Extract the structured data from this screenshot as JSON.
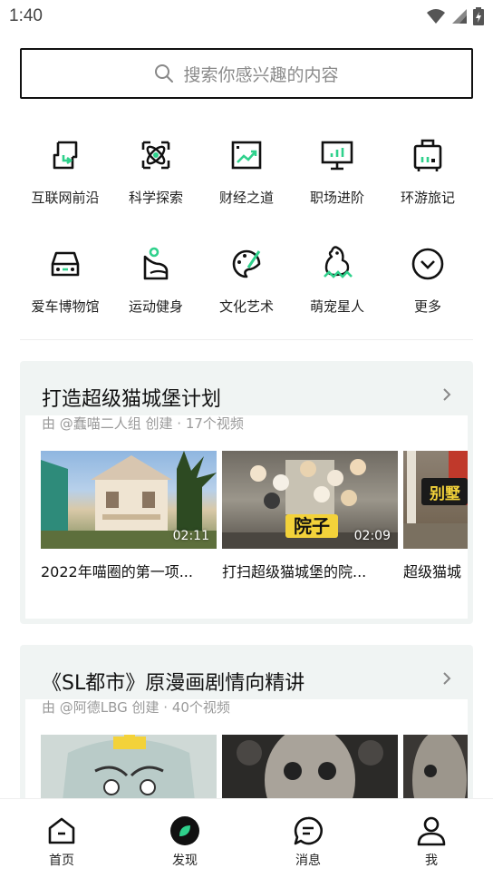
{
  "status": {
    "time": "1:40"
  },
  "search": {
    "placeholder": "搜索你感兴趣的内容"
  },
  "categories": [
    {
      "label": "互联网前沿",
      "icon": "internet-icon"
    },
    {
      "label": "科学探索",
      "icon": "science-icon"
    },
    {
      "label": "财经之道",
      "icon": "finance-icon"
    },
    {
      "label": "职场进阶",
      "icon": "career-icon"
    },
    {
      "label": "环游旅记",
      "icon": "travel-icon"
    },
    {
      "label": "爱车博物馆",
      "icon": "car-icon"
    },
    {
      "label": "运动健身",
      "icon": "fitness-icon"
    },
    {
      "label": "文化艺术",
      "icon": "art-icon"
    },
    {
      "label": "萌宠星人",
      "icon": "pet-icon"
    },
    {
      "label": "更多",
      "icon": "more-icon"
    }
  ],
  "collections": [
    {
      "title": "打造超级猫城堡计划",
      "subtitle": "由 @蠢喵二人组 创建 · 17个视频",
      "videos": [
        {
          "title": "2022年喵圈的第一项...",
          "duration": "02:11"
        },
        {
          "title": "打扫超级猫城堡的院...",
          "duration": "02:09",
          "overlay_text": "院子"
        },
        {
          "title": "超级猫城",
          "duration": "",
          "overlay_text": "别墅"
        }
      ]
    },
    {
      "title": "《SL都市》原漫画剧情向精讲",
      "subtitle": "由 @阿德LBG 创建 · 40个视频",
      "videos": [
        {
          "title": "",
          "duration": ""
        },
        {
          "title": "",
          "duration": ""
        },
        {
          "title": "",
          "duration": ""
        }
      ]
    }
  ],
  "nav": [
    {
      "label": "首页",
      "icon": "home-icon"
    },
    {
      "label": "发现",
      "icon": "discover-icon",
      "active": true
    },
    {
      "label": "消息",
      "icon": "message-icon"
    },
    {
      "label": "我",
      "icon": "profile-icon"
    }
  ],
  "colors": {
    "accent": "#2fd18c",
    "ink": "#111111"
  }
}
